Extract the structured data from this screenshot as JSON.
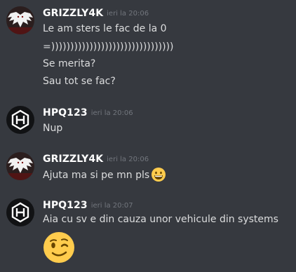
{
  "messages": [
    {
      "username": "GRIZZLY4K",
      "timestamp": "ieri la 20:06",
      "lines": [
        "Le am sters le fac de la 0",
        "=))))))))))))))))))))))))))))))))",
        "Se merita?",
        "Sau tot se fac?"
      ],
      "avatar_icon": "winged-creature-icon"
    },
    {
      "username": "HPQ123",
      "timestamp": "ieri la 20:06",
      "lines": [
        "Nup"
      ],
      "avatar_icon": "hexagon-logo-icon"
    },
    {
      "username": "GRIZZLY4K",
      "timestamp": "ieri la 20:06",
      "lines": [
        "Ajuta ma si pe mn pls"
      ],
      "emoji": "grinning-face-icon",
      "avatar_icon": "winged-creature-icon"
    },
    {
      "username": "HPQ123",
      "timestamp": "ieri la 20:07",
      "lines": [
        "Aia cu sv e din cauza unor vehicule din systems"
      ],
      "emoji": "winking-face-icon",
      "avatar_icon": "hexagon-logo-icon"
    }
  ],
  "colors": {
    "background": "#36393f",
    "username": "#ffffff",
    "timestamp": "#72767d",
    "text": "#dcddde",
    "emoji_yellow": "#ffcc4d"
  }
}
